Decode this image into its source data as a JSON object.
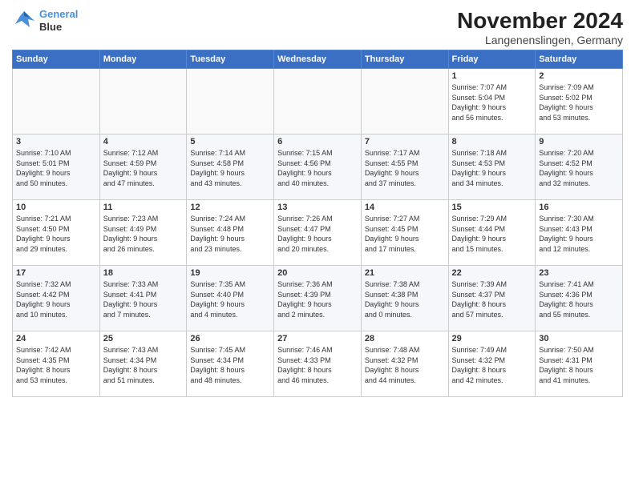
{
  "header": {
    "logo_line1": "General",
    "logo_line2": "Blue",
    "month": "November 2024",
    "location": "Langenenslingen, Germany"
  },
  "weekdays": [
    "Sunday",
    "Monday",
    "Tuesday",
    "Wednesday",
    "Thursday",
    "Friday",
    "Saturday"
  ],
  "weeks": [
    [
      {
        "day": "",
        "info": ""
      },
      {
        "day": "",
        "info": ""
      },
      {
        "day": "",
        "info": ""
      },
      {
        "day": "",
        "info": ""
      },
      {
        "day": "",
        "info": ""
      },
      {
        "day": "1",
        "info": "Sunrise: 7:07 AM\nSunset: 5:04 PM\nDaylight: 9 hours\nand 56 minutes."
      },
      {
        "day": "2",
        "info": "Sunrise: 7:09 AM\nSunset: 5:02 PM\nDaylight: 9 hours\nand 53 minutes."
      }
    ],
    [
      {
        "day": "3",
        "info": "Sunrise: 7:10 AM\nSunset: 5:01 PM\nDaylight: 9 hours\nand 50 minutes."
      },
      {
        "day": "4",
        "info": "Sunrise: 7:12 AM\nSunset: 4:59 PM\nDaylight: 9 hours\nand 47 minutes."
      },
      {
        "day": "5",
        "info": "Sunrise: 7:14 AM\nSunset: 4:58 PM\nDaylight: 9 hours\nand 43 minutes."
      },
      {
        "day": "6",
        "info": "Sunrise: 7:15 AM\nSunset: 4:56 PM\nDaylight: 9 hours\nand 40 minutes."
      },
      {
        "day": "7",
        "info": "Sunrise: 7:17 AM\nSunset: 4:55 PM\nDaylight: 9 hours\nand 37 minutes."
      },
      {
        "day": "8",
        "info": "Sunrise: 7:18 AM\nSunset: 4:53 PM\nDaylight: 9 hours\nand 34 minutes."
      },
      {
        "day": "9",
        "info": "Sunrise: 7:20 AM\nSunset: 4:52 PM\nDaylight: 9 hours\nand 32 minutes."
      }
    ],
    [
      {
        "day": "10",
        "info": "Sunrise: 7:21 AM\nSunset: 4:50 PM\nDaylight: 9 hours\nand 29 minutes."
      },
      {
        "day": "11",
        "info": "Sunrise: 7:23 AM\nSunset: 4:49 PM\nDaylight: 9 hours\nand 26 minutes."
      },
      {
        "day": "12",
        "info": "Sunrise: 7:24 AM\nSunset: 4:48 PM\nDaylight: 9 hours\nand 23 minutes."
      },
      {
        "day": "13",
        "info": "Sunrise: 7:26 AM\nSunset: 4:47 PM\nDaylight: 9 hours\nand 20 minutes."
      },
      {
        "day": "14",
        "info": "Sunrise: 7:27 AM\nSunset: 4:45 PM\nDaylight: 9 hours\nand 17 minutes."
      },
      {
        "day": "15",
        "info": "Sunrise: 7:29 AM\nSunset: 4:44 PM\nDaylight: 9 hours\nand 15 minutes."
      },
      {
        "day": "16",
        "info": "Sunrise: 7:30 AM\nSunset: 4:43 PM\nDaylight: 9 hours\nand 12 minutes."
      }
    ],
    [
      {
        "day": "17",
        "info": "Sunrise: 7:32 AM\nSunset: 4:42 PM\nDaylight: 9 hours\nand 10 minutes."
      },
      {
        "day": "18",
        "info": "Sunrise: 7:33 AM\nSunset: 4:41 PM\nDaylight: 9 hours\nand 7 minutes."
      },
      {
        "day": "19",
        "info": "Sunrise: 7:35 AM\nSunset: 4:40 PM\nDaylight: 9 hours\nand 4 minutes."
      },
      {
        "day": "20",
        "info": "Sunrise: 7:36 AM\nSunset: 4:39 PM\nDaylight: 9 hours\nand 2 minutes."
      },
      {
        "day": "21",
        "info": "Sunrise: 7:38 AM\nSunset: 4:38 PM\nDaylight: 9 hours\nand 0 minutes."
      },
      {
        "day": "22",
        "info": "Sunrise: 7:39 AM\nSunset: 4:37 PM\nDaylight: 8 hours\nand 57 minutes."
      },
      {
        "day": "23",
        "info": "Sunrise: 7:41 AM\nSunset: 4:36 PM\nDaylight: 8 hours\nand 55 minutes."
      }
    ],
    [
      {
        "day": "24",
        "info": "Sunrise: 7:42 AM\nSunset: 4:35 PM\nDaylight: 8 hours\nand 53 minutes."
      },
      {
        "day": "25",
        "info": "Sunrise: 7:43 AM\nSunset: 4:34 PM\nDaylight: 8 hours\nand 51 minutes."
      },
      {
        "day": "26",
        "info": "Sunrise: 7:45 AM\nSunset: 4:34 PM\nDaylight: 8 hours\nand 48 minutes."
      },
      {
        "day": "27",
        "info": "Sunrise: 7:46 AM\nSunset: 4:33 PM\nDaylight: 8 hours\nand 46 minutes."
      },
      {
        "day": "28",
        "info": "Sunrise: 7:48 AM\nSunset: 4:32 PM\nDaylight: 8 hours\nand 44 minutes."
      },
      {
        "day": "29",
        "info": "Sunrise: 7:49 AM\nSunset: 4:32 PM\nDaylight: 8 hours\nand 42 minutes."
      },
      {
        "day": "30",
        "info": "Sunrise: 7:50 AM\nSunset: 4:31 PM\nDaylight: 8 hours\nand 41 minutes."
      }
    ]
  ]
}
